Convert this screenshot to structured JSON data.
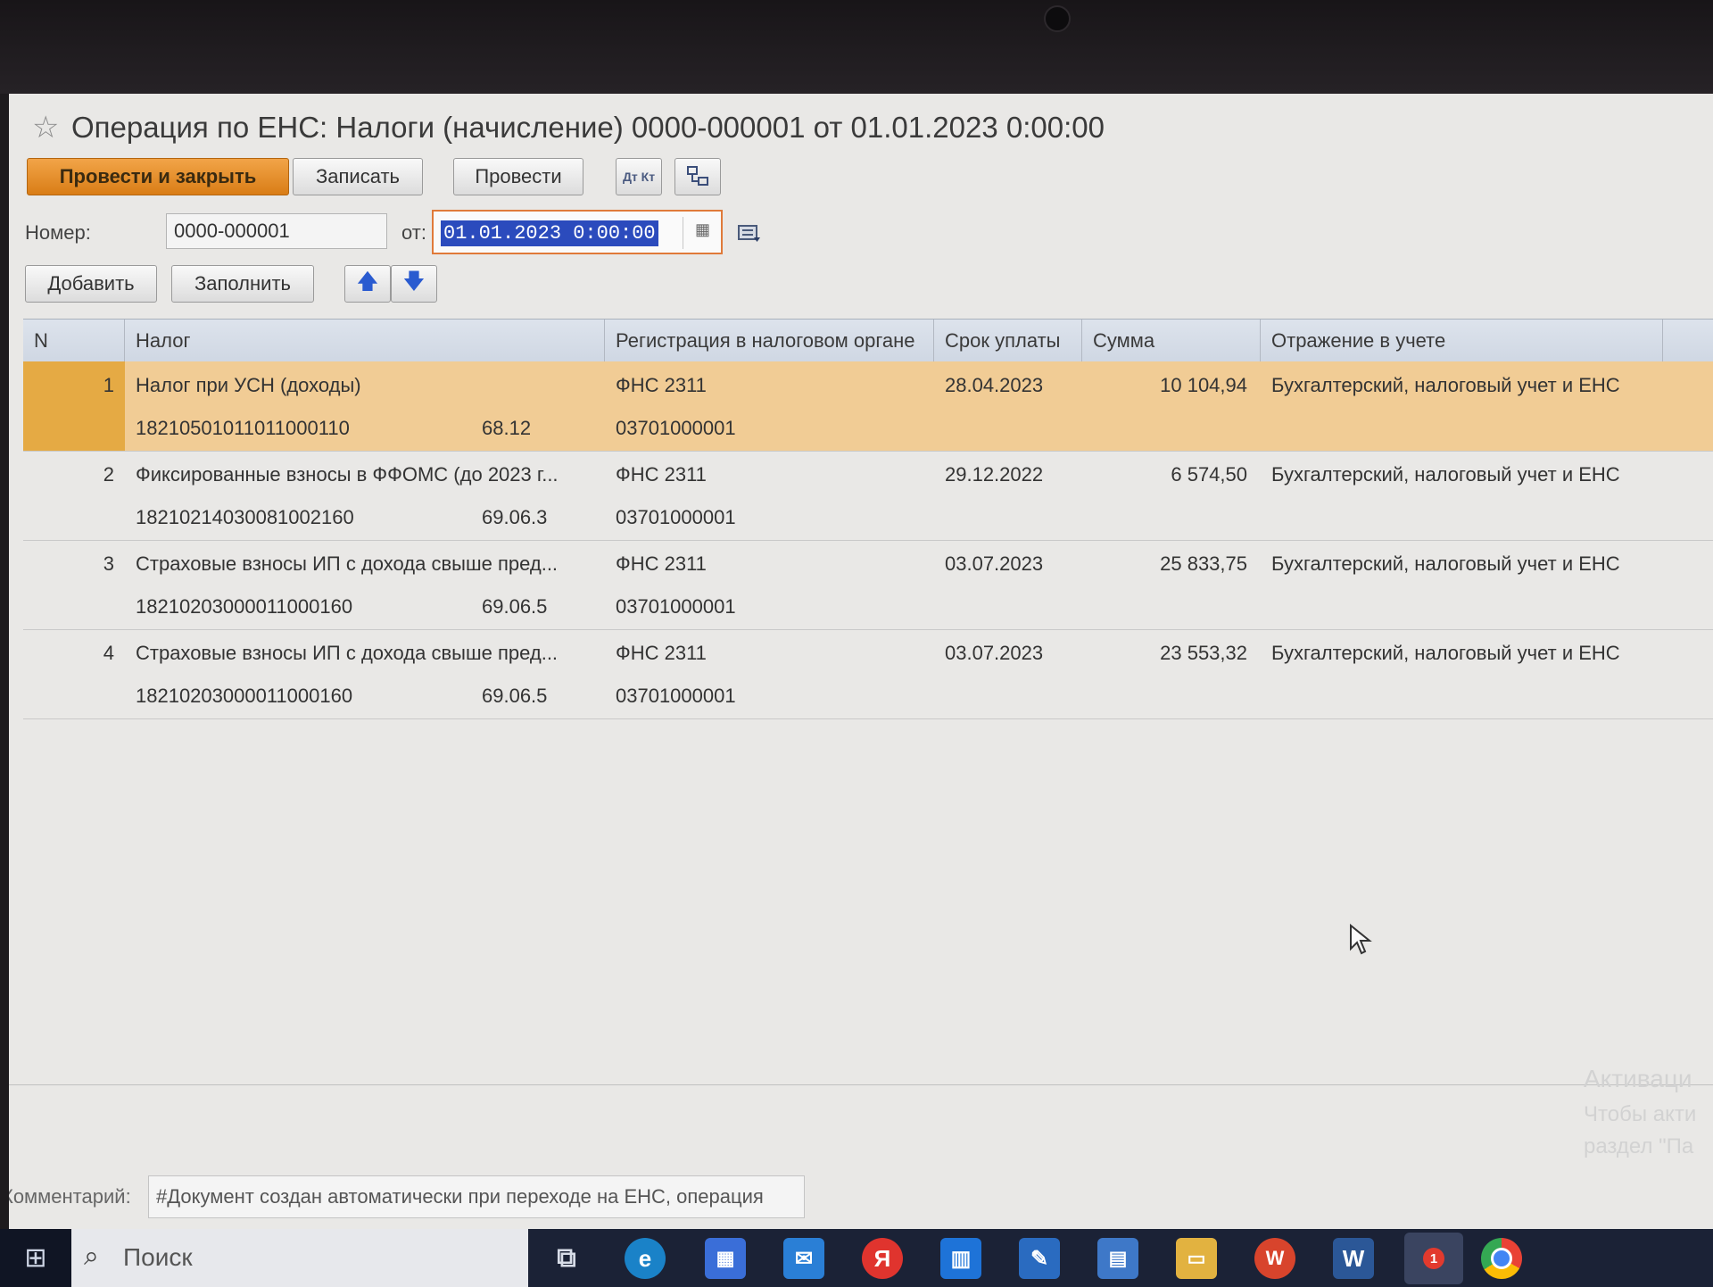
{
  "window": {
    "title": "Операция по ЕНС: Налоги (начисление) 0000-000001 от 01.01.2023 0:00:00"
  },
  "toolbar": {
    "post_close": "Провести и закрыть",
    "save": "Записать",
    "post": "Провести",
    "dt_kt_icon": "Дт Кт"
  },
  "form": {
    "number_label": "Номер:",
    "number_value": "0000-000001",
    "date_label": "от:",
    "date_value": "01.01.2023  0:00:00"
  },
  "table_toolbar": {
    "add": "Добавить",
    "fill": "Заполнить",
    "up_arrow": "🡅",
    "down_arrow": "🡇"
  },
  "table": {
    "headers": [
      "N",
      "Налог",
      "Регистрация в налоговом органе",
      "Срок уплаты",
      "Сумма",
      "Отражение в учете"
    ],
    "rows": [
      {
        "n": "1",
        "tax": "Налог при УСН (доходы)",
        "kbk": "18210501011011000110",
        "account": "68.12",
        "registration": "ФНС 2311",
        "oktmo": "03701000001",
        "due_date": "28.04.2023",
        "amount": "10 104,94",
        "reflection": "Бухгалтерский, налоговый учет и ЕНС"
      },
      {
        "n": "2",
        "tax": "Фиксированные взносы в ФФОМС (до 2023 г...",
        "kbk": "18210214030081002160",
        "account": "69.06.3",
        "registration": "ФНС 2311",
        "oktmo": "03701000001",
        "due_date": "29.12.2022",
        "amount": "6 574,50",
        "reflection": "Бухгалтерский, налоговый учет и ЕНС"
      },
      {
        "n": "3",
        "tax": "Страховые взносы ИП с дохода свыше пред...",
        "kbk": "18210203000011000160",
        "account": "69.06.5",
        "registration": "ФНС 2311",
        "oktmo": "03701000001",
        "due_date": "03.07.2023",
        "amount": "25 833,75",
        "reflection": "Бухгалтерский, налоговый учет и ЕНС"
      },
      {
        "n": "4",
        "tax": "Страховые взносы ИП с дохода свыше пред...",
        "kbk": "18210203000011000160",
        "account": "69.06.5",
        "registration": "ФНС 2311",
        "oktmo": "03701000001",
        "due_date": "03.07.2023",
        "amount": "23 553,32",
        "reflection": "Бухгалтерский, налоговый учет и ЕНС"
      }
    ]
  },
  "comment": {
    "label": "Комментарий:",
    "value": "#Документ создан автоматически при переходе на ЕНС, операция"
  },
  "watermark": {
    "line1": "Активаци",
    "line2": "Чтобы акти",
    "line3": "раздел \"Па"
  },
  "taskbar": {
    "search_placeholder": "Поиск",
    "yandex_letter": "Я",
    "word_letter": "W",
    "badge_count": "1"
  },
  "colors": {
    "primary_button": "#e08a24",
    "selected_row": "#f1cc95",
    "date_selection": "#2b4bbd"
  }
}
